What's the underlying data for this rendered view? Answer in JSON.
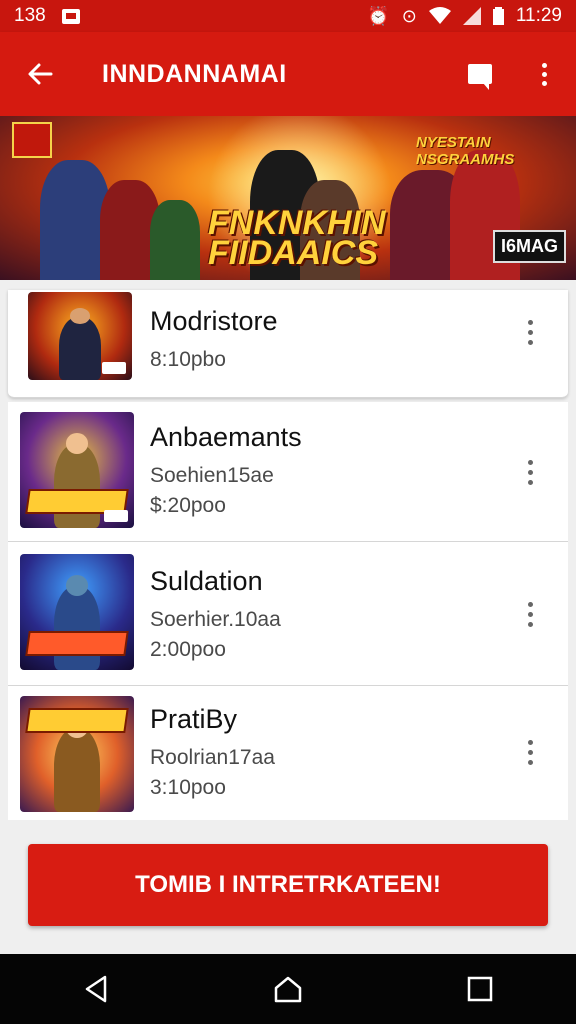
{
  "status_bar": {
    "time_left": "138",
    "time": "11:29",
    "icons": [
      "notification-icon",
      "alarm-icon",
      "clock-icon",
      "wifi-icon",
      "signal-icon",
      "battery-icon"
    ]
  },
  "app_bar": {
    "title": "INNDANNAMAI",
    "icons": [
      "back-arrow-icon",
      "chat-icon",
      "overflow-menu-icon"
    ]
  },
  "banner": {
    "title": "FNKNKHIN FIIDAAICS",
    "side_title": "NYESTAIN NSGRAAMHS",
    "tag": "I6MAG"
  },
  "items": [
    {
      "title": "Modristore",
      "line1": "",
      "line2": "8:10pbo"
    },
    {
      "title": "Anbaemants",
      "line1": "Soehien15ae",
      "line2": "$:20poo"
    },
    {
      "title": "Suldation",
      "line1": "Soerhier.10aa",
      "line2": "2:00poo"
    },
    {
      "title": "PratiBy",
      "line1": "Roolrian17aa",
      "line2": "3:10poo"
    }
  ],
  "cta": {
    "label": "TOMIB I INTRETRKATEEN!"
  },
  "colors": {
    "primary": "#d51a10",
    "status": "#c8160e",
    "cta": "#d81c12"
  }
}
